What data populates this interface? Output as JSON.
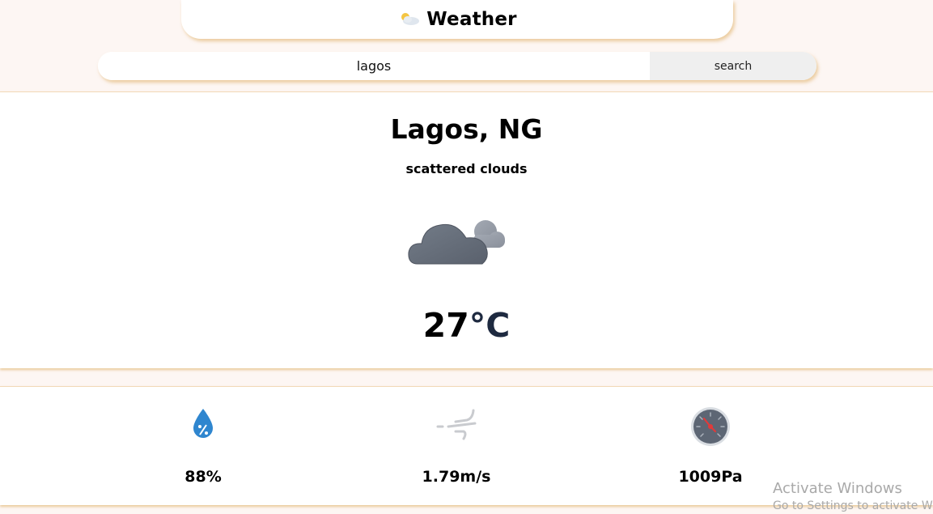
{
  "header": {
    "title": "Weather",
    "icon": "partly-cloudy-icon"
  },
  "search": {
    "value": "lagos",
    "placeholder": "",
    "button_label": "search"
  },
  "current": {
    "city": "Lagos, NG",
    "description": "scattered clouds",
    "icon": "cloud-moon-icon",
    "temp_value": "27",
    "temp_unit": "°C"
  },
  "stats": [
    {
      "name": "humidity",
      "icon": "humidity-drop-icon",
      "value": "88%"
    },
    {
      "name": "wind",
      "icon": "wind-icon",
      "value": "1.79m/s"
    },
    {
      "name": "pressure",
      "icon": "pressure-gauge-icon",
      "value": "1009Pa"
    }
  ],
  "watermark": {
    "line1": "Activate Windows",
    "line2": "Go to Settings to activate Windows."
  },
  "colors": {
    "background": "#fdf6f3",
    "accent_shadow": "#dcaa5a",
    "humidity_blue": "#2f86cf"
  }
}
